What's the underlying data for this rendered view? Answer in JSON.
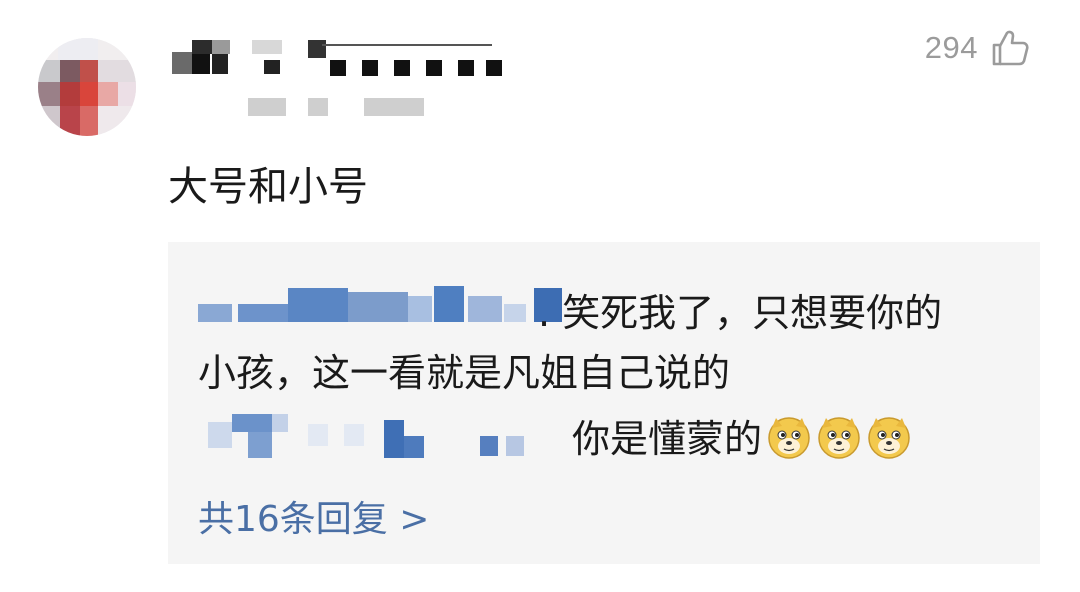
{
  "comment": {
    "likes": "294",
    "text": "大号和小号",
    "replies": {
      "reply1_line1_tail": ". 笑死我了，只想要你的",
      "reply1_line2": "小孩，这一看就是凡姐自己说的",
      "reply2_tail": "你是懂蒙的",
      "emojis": [
        "doge-emoji",
        "doge-emoji",
        "doge-emoji"
      ],
      "more_label": "共16条回复 >"
    }
  },
  "colors": {
    "link": "#4a6fa5",
    "like_count": "#9b9b9b",
    "reply_bg": "#f5f5f5"
  },
  "icons": {
    "like": "thumbs-up-outline-icon",
    "emoji": "doge-emoji"
  }
}
